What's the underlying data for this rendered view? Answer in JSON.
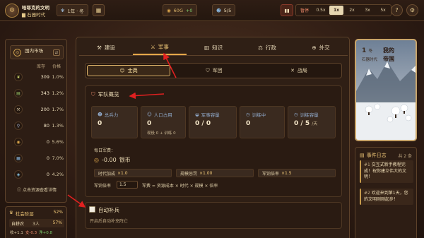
{
  "topbar": {
    "civ_name": "哈耶克的文明",
    "era": "石器时代",
    "date": "1年 · 冬",
    "money": "60G",
    "money_delta": "+0",
    "population": "5/5",
    "pause_label": "暂停",
    "speeds": [
      "0.5x",
      "1x",
      "2x",
      "3x",
      "5x"
    ],
    "active_speed": "1x"
  },
  "market": {
    "title": "国内市场",
    "col_stock": "库存",
    "col_price": "价格",
    "resources": [
      {
        "icon": "wheat-icon",
        "glyph": "❦",
        "color": "#c9d46a",
        "stock": "309",
        "price": "1.0%"
      },
      {
        "icon": "log-icon",
        "glyph": "▤",
        "color": "#9ac86a",
        "stock": "343",
        "price": "1.2%"
      },
      {
        "icon": "pickaxe-icon",
        "glyph": "⚒",
        "color": "#b9a88a",
        "stock": "200",
        "price": "1.7%"
      },
      {
        "icon": "tool-icon",
        "glyph": "⚲",
        "color": "#a8b8d8",
        "stock": "80",
        "price": "1.3%"
      },
      {
        "icon": "coin-icon",
        "glyph": "◉",
        "color": "#d9a44a",
        "stock": "0",
        "price": "5.6%"
      },
      {
        "icon": "cloth-icon",
        "glyph": "▦",
        "color": "#8ab8e0",
        "stock": "0",
        "price": "7.0%"
      },
      {
        "icon": "gem-icon",
        "glyph": "◈",
        "color": "#8ac8e8",
        "stock": "0",
        "price": "4.2%"
      }
    ],
    "footer": "点击资源查看详情"
  },
  "social": {
    "title": "社会阶层",
    "pct": "52%",
    "class_name": "自耕农",
    "class_count": "3人",
    "class_pct": "57%",
    "income": "收+1.1",
    "expense": "支-0.3",
    "net": "净+0.8"
  },
  "tabs": {
    "items": [
      {
        "label": "建设",
        "icon": "hammer-icon",
        "glyph": "⚒"
      },
      {
        "label": "军事",
        "icon": "swords-icon",
        "glyph": "⚔"
      },
      {
        "label": "知识",
        "icon": "book-icon",
        "glyph": "▥"
      },
      {
        "label": "行政",
        "icon": "scale-icon",
        "glyph": "⚖"
      },
      {
        "label": "外交",
        "icon": "globe-icon",
        "glyph": "⊕"
      }
    ],
    "active": 1
  },
  "subtabs": {
    "items": [
      {
        "label": "士兵",
        "icon": "soldier-icon",
        "glyph": "☺"
      },
      {
        "label": "军团",
        "icon": "shield-icon",
        "glyph": "⛉"
      },
      {
        "label": "战局",
        "icon": "battle-icon",
        "glyph": "✕"
      }
    ],
    "active": 0
  },
  "overview": {
    "title": "军队概览",
    "stats": [
      {
        "label": "总兵力",
        "icon": "people-icon",
        "glyph": "☻",
        "value": "0",
        "unit": "",
        "sub": ""
      },
      {
        "label": "人口占用",
        "icon": "user-icon",
        "glyph": "☺",
        "value": "0",
        "unit": "",
        "sub": "现役 0 + 训练 0"
      },
      {
        "label": "军事容量",
        "icon": "helmet-icon",
        "glyph": "◒",
        "value": "0 / 0",
        "unit": "",
        "sub": ""
      },
      {
        "label": "训练中",
        "icon": "clock-icon",
        "glyph": "◷",
        "value": "0",
        "unit": "",
        "sub": ""
      },
      {
        "label": "训练容量",
        "icon": "clock-icon",
        "glyph": "◷",
        "value": "0 / 5",
        "unit": "/天",
        "sub": ""
      }
    ],
    "upkeep_label": "每日军费：",
    "upkeep_value": "-0.00",
    "upkeep_unit": "银币",
    "bonuses": [
      {
        "label": "时代加成",
        "value": "×1.0"
      },
      {
        "label": "规模惩罚",
        "value": "×1.00"
      },
      {
        "label": "军饷倍率",
        "value": "×1.5"
      }
    ],
    "mult_label": "军饷倍率",
    "mult_value": "1.5",
    "formula": "军费 = 资源成本 × 时代 × 规模 × 倍率"
  },
  "auto_recruit": {
    "title": "自动补兵",
    "desc": "开启后自动补充阵亡"
  },
  "empire": {
    "season_num": "1",
    "season_word": "冬",
    "era": "石器时代",
    "name": "我的\n帝国"
  },
  "events": {
    "title": "事件日志",
    "count": "共 2 条",
    "items": [
      {
        "num": "#1",
        "text": "交互式新手教程完成！祝你建立伟大的文明！"
      },
      {
        "num": "#2",
        "text": "欢迎来到第1天，您的文明刚刚起步！"
      }
    ]
  }
}
